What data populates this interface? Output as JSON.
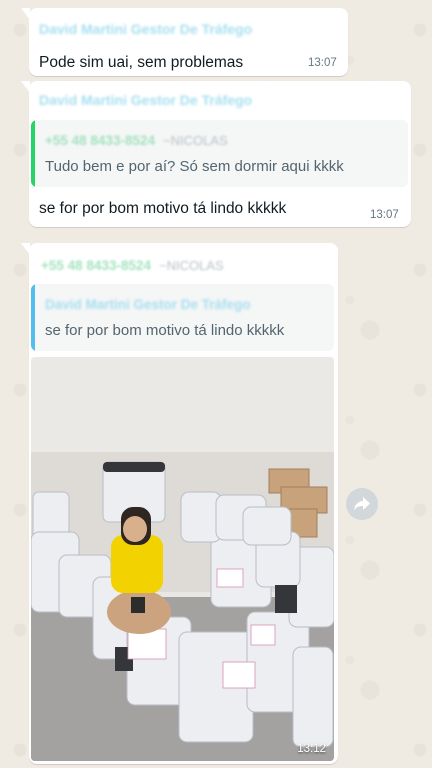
{
  "messages": [
    {
      "sender": "David Martini Gestor De Tráfego",
      "text": "Pode sim uai, sem problemas",
      "time": "13:07"
    },
    {
      "sender": "David Martini Gestor De Tráfego",
      "quote": {
        "phone": "+55 48 8433-8524",
        "name": "~NICOLAS",
        "text": "Tudo bem e por aí? Só sem dormir aqui kkkk"
      },
      "text": "se for por bom motivo tá lindo kkkkk",
      "time": "13:07"
    },
    {
      "sender_phone": "+55 48 8433-8524",
      "sender_name": "~NICOLAS",
      "quote": {
        "sender": "David Martini Gestor De Tráfego",
        "text": "se for por bom motivo tá lindo kkkkk"
      },
      "image": "photo of a woman sitting among many packaging bags and boxes",
      "time": "13:12"
    }
  ],
  "colors": {
    "background": "#efeae2",
    "bubble": "#ffffff",
    "quote_bar_green": "#25d366",
    "quote_bar_blue": "#53bdeb"
  },
  "icons": {
    "forward": "forward-share-icon"
  }
}
